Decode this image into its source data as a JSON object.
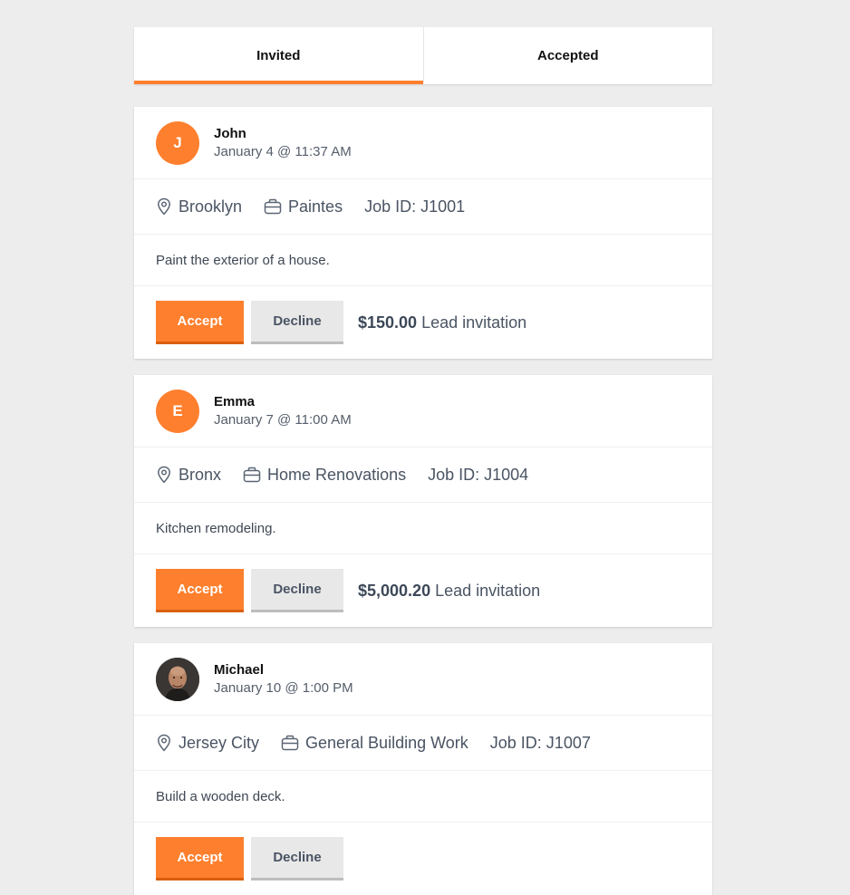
{
  "tabs": [
    {
      "label": "Invited",
      "active": true
    },
    {
      "label": "Accepted",
      "active": false
    }
  ],
  "accent_color": "#fe7f2d",
  "cards": [
    {
      "avatar_initial": "J",
      "avatar_type": "initial",
      "name": "John",
      "date": "January 4 @ 11:37 AM",
      "location": "Brooklyn",
      "category": "Paintes",
      "job_id": "Job ID: J1001",
      "description": "Paint the exterior of a house.",
      "accept_label": "Accept",
      "decline_label": "Decline",
      "price": "$150.00",
      "price_suffix": "Lead invitation"
    },
    {
      "avatar_initial": "E",
      "avatar_type": "initial",
      "name": "Emma",
      "date": "January 7 @ 11:00 AM",
      "location": "Bronx",
      "category": "Home Renovations",
      "job_id": "Job ID: J1004",
      "description": "Kitchen remodeling.",
      "accept_label": "Accept",
      "decline_label": "Decline",
      "price": "$5,000.20",
      "price_suffix": "Lead invitation"
    },
    {
      "avatar_initial": "",
      "avatar_type": "photo",
      "name": "Michael",
      "date": "January 10 @ 1:00 PM",
      "location": "Jersey City",
      "category": "General Building Work",
      "job_id": "Job ID: J1007",
      "description": "Build a wooden deck.",
      "accept_label": "Accept",
      "decline_label": "Decline",
      "price": "",
      "price_suffix": ""
    }
  ]
}
